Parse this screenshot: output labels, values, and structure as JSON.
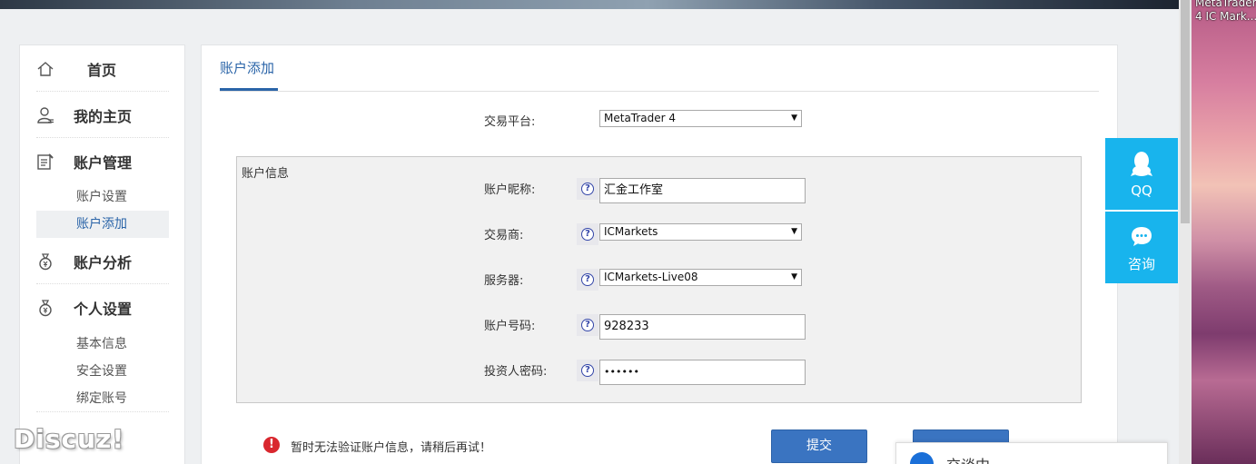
{
  "desktop_label": [
    "MetaTrader",
    "4 IC Mark..."
  ],
  "sidebar": {
    "items": [
      {
        "label": "首页",
        "icon": "home-icon"
      },
      {
        "label": "我的主页",
        "icon": "user-icon"
      },
      {
        "label": "账户管理",
        "icon": "edit-list-icon",
        "children": [
          {
            "label": "账户设置"
          },
          {
            "label": "账户添加",
            "active": true
          }
        ]
      },
      {
        "label": "账户分析",
        "icon": "money-bag-icon"
      },
      {
        "label": "个人设置",
        "icon": "money-bag-icon",
        "children": [
          {
            "label": "基本信息"
          },
          {
            "label": "安全设置"
          },
          {
            "label": "绑定账号"
          }
        ]
      }
    ]
  },
  "main": {
    "tab": "账户添加",
    "platform": {
      "label": "交易平台:",
      "value": "MetaTrader 4"
    },
    "fieldset_legend": "账户信息",
    "fields": {
      "nickname": {
        "label": "账户昵称:",
        "value": "汇金工作室"
      },
      "broker": {
        "label": "交易商:",
        "value": "ICMarkets"
      },
      "server": {
        "label": "服务器:",
        "value": "ICMarkets-Live08"
      },
      "account_number": {
        "label": "账户号码:",
        "value": "928233"
      },
      "investor_password": {
        "label": "投资人密码:",
        "value": "••••••"
      }
    },
    "help_glyph": "?",
    "error_message": "暂时无法验证账户信息，请稍后再试！",
    "submit_label": "提交",
    "second_button_label": ""
  },
  "float_panel": {
    "qq_label": "QQ",
    "consult_label": "咨询"
  },
  "chat": {
    "status": "交谈中"
  },
  "watermark": "Discuz!",
  "colors": {
    "accent": "#2a64a8",
    "button": "#3a74c1",
    "float_panel": "#18b4ed",
    "error": "#d9272e"
  }
}
